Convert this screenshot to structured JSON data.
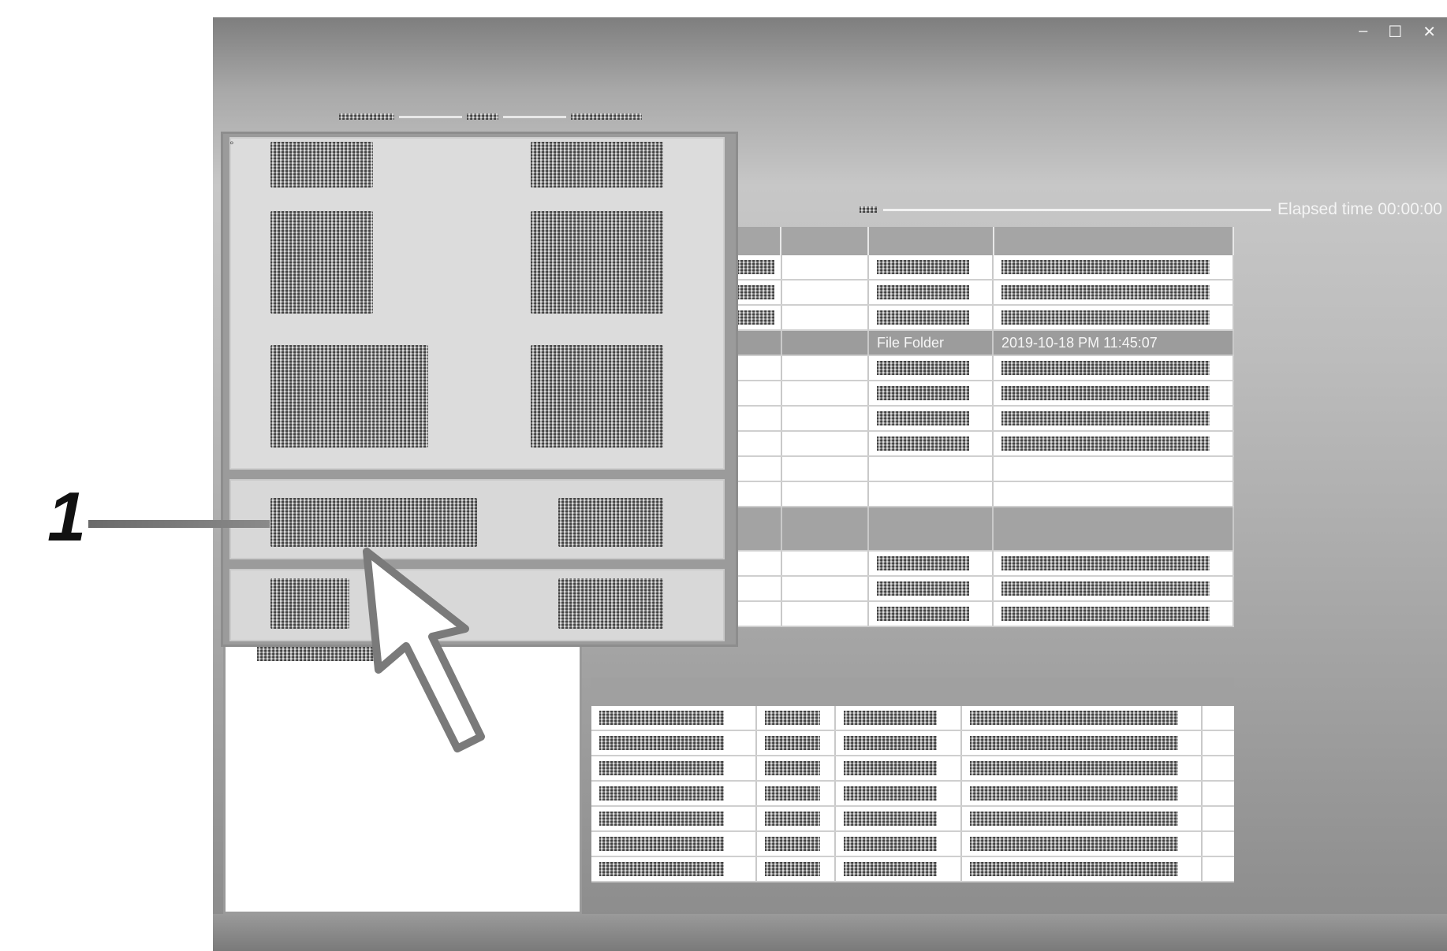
{
  "window": {
    "controls": {
      "minimize": "–",
      "restore": "☐",
      "close": "✕"
    }
  },
  "header": {
    "elapsed_label": "Elapsed time 00:00:00"
  },
  "list": {
    "selected_row": {
      "type": "File Folder",
      "date": "2019-10-18 PM 11:45:07"
    }
  },
  "callout": {
    "number": "1"
  },
  "colors": {
    "window_gray": "#a9a9a9",
    "selected_row": "#9c9c9c",
    "callout_text": "#111111"
  },
  "icons": [
    "minimize-icon",
    "restore-icon",
    "close-icon",
    "pointer-arrow-icon"
  ]
}
